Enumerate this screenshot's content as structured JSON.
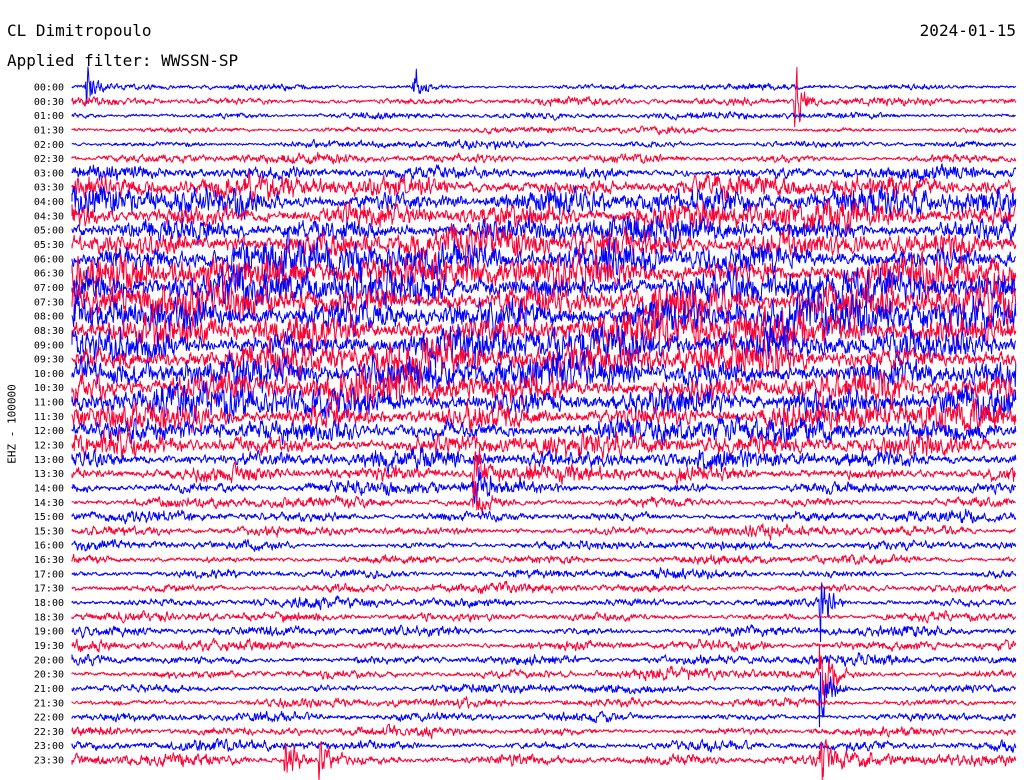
{
  "header": {
    "station": "CL Dimitropoulo",
    "date": "2024-01-15",
    "filter_label": "Applied filter: WWSSN-SP"
  },
  "chart_data": {
    "type": "line",
    "subtype": "helicorder",
    "ylabel": "EHZ - 100000",
    "row_labels": [
      "00:00",
      "00:30",
      "01:00",
      "01:30",
      "02:00",
      "02:30",
      "03:00",
      "03:30",
      "04:00",
      "04:30",
      "05:00",
      "05:30",
      "06:00",
      "06:30",
      "07:00",
      "07:30",
      "08:00",
      "08:30",
      "09:00",
      "09:30",
      "10:00",
      "10:30",
      "11:00",
      "11:30",
      "12:00",
      "12:30",
      "13:00",
      "13:30",
      "14:00",
      "14:30",
      "15:00",
      "15:30",
      "16:00",
      "16:30",
      "17:00",
      "17:30",
      "18:00",
      "18:30",
      "19:00",
      "19:30",
      "20:00",
      "20:30",
      "21:00",
      "21:30",
      "22:00",
      "22:30",
      "23:00",
      "23:30"
    ],
    "minutes_per_row": 30,
    "trace_colors": [
      "#0000ff",
      "#ff0033"
    ],
    "relative_amplitude": [
      0.6,
      0.8,
      0.7,
      0.6,
      0.7,
      0.9,
      1.3,
      2.2,
      2.8,
      2.7,
      2.6,
      3.0,
      3.4,
      3.6,
      3.8,
      3.6,
      3.8,
      3.8,
      3.6,
      3.5,
      3.4,
      3.3,
      3.1,
      2.7,
      2.5,
      2.2,
      1.9,
      1.6,
      1.2,
      1.0,
      1.0,
      1.0,
      0.9,
      0.9,
      0.9,
      0.9,
      0.9,
      0.9,
      1.0,
      1.0,
      1.0,
      1.0,
      0.9,
      0.9,
      0.9,
      0.9,
      1.0,
      1.2
    ],
    "events": [
      {
        "row": 0,
        "minute": 0.5,
        "amplitude": 1.5
      },
      {
        "row": 0,
        "minute": 10.9,
        "amplitude": 1.5
      },
      {
        "row": 1,
        "minute": 23.0,
        "amplitude": 2.5
      },
      {
        "row": 28,
        "minute": 12.8,
        "amplitude": 3.0
      },
      {
        "row": 27,
        "minute": 12.8,
        "amplitude": 2.5
      },
      {
        "row": 29,
        "minute": 12.8,
        "amplitude": 2.0
      },
      {
        "row": 41,
        "minute": 23.8,
        "amplitude": 4.0
      },
      {
        "row": 42,
        "minute": 23.8,
        "amplitude": 3.0
      },
      {
        "row": 36,
        "minute": 23.8,
        "amplitude": 3.0
      },
      {
        "row": 47,
        "minute": 6.8,
        "amplitude": 2.5
      },
      {
        "row": 47,
        "minute": 7.9,
        "amplitude": 2.0
      },
      {
        "row": 47,
        "minute": 23.8,
        "amplitude": 2.5
      }
    ]
  }
}
